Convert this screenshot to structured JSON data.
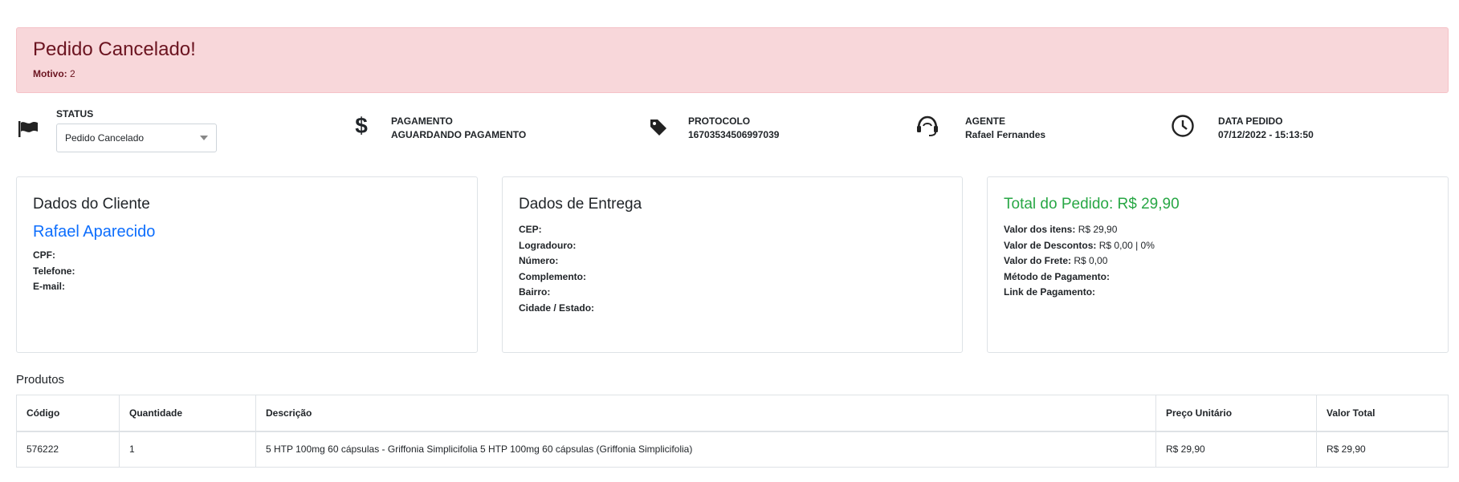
{
  "alert": {
    "title": "Pedido Cancelado!",
    "reason_label": "Motivo:",
    "reason_value": "2"
  },
  "info": {
    "status": {
      "label": "STATUS",
      "selected": "Pedido Cancelado",
      "icon": "flag-icon"
    },
    "payment": {
      "label": "PAGAMENTO",
      "value": "AGUARDANDO PAGAMENTO",
      "icon": "dollar-icon"
    },
    "protocol": {
      "label": "PROTOCOLO",
      "value": "16703534506997039",
      "icon": "tag-icon"
    },
    "agent": {
      "label": "AGENTE",
      "value": "Rafael Fernandes",
      "icon": "headset-icon"
    },
    "date": {
      "label": "DATA PEDIDO",
      "value": "07/12/2022 - 15:13:50",
      "icon": "clock-icon"
    }
  },
  "client": {
    "title": "Dados do Cliente",
    "name": "Rafael Aparecido",
    "cpf_label": "CPF:",
    "phone_label": "Telefone:",
    "email_label": "E-mail:"
  },
  "delivery": {
    "title": "Dados de Entrega",
    "cep_label": "CEP:",
    "street_label": "Logradouro:",
    "number_label": "Número:",
    "complement_label": "Complemento:",
    "district_label": "Bairro:",
    "city_label": "Cidade / Estado:"
  },
  "total": {
    "title": "Total do Pedido: R$ 29,90",
    "items_label": "Valor dos itens:",
    "items_value": "R$ 29,90",
    "discount_label": "Valor de Descontos:",
    "discount_value": "R$ 0,00 | 0%",
    "freight_label": "Valor do Frete:",
    "freight_value": "R$ 0,00",
    "method_label": "Método de Pagamento:",
    "link_label": "Link de Pagamento:"
  },
  "products": {
    "label": "Produtos",
    "headers": [
      "Código",
      "Quantidade",
      "Descrição",
      "Preço Unitário",
      "Valor Total"
    ],
    "rows": [
      [
        "576222",
        "1",
        "5 HTP 100mg 60 cápsulas - Griffonia Simplicifolia 5 HTP 100mg 60 cápsulas (Griffonia Simplicifolia)",
        "R$ 29,90",
        "R$ 29,90"
      ]
    ]
  },
  "colors": {
    "alert_bg": "#f8d7da",
    "alert_text": "#6b1420",
    "link_blue": "#0d6efd",
    "total_green": "#28a745"
  }
}
